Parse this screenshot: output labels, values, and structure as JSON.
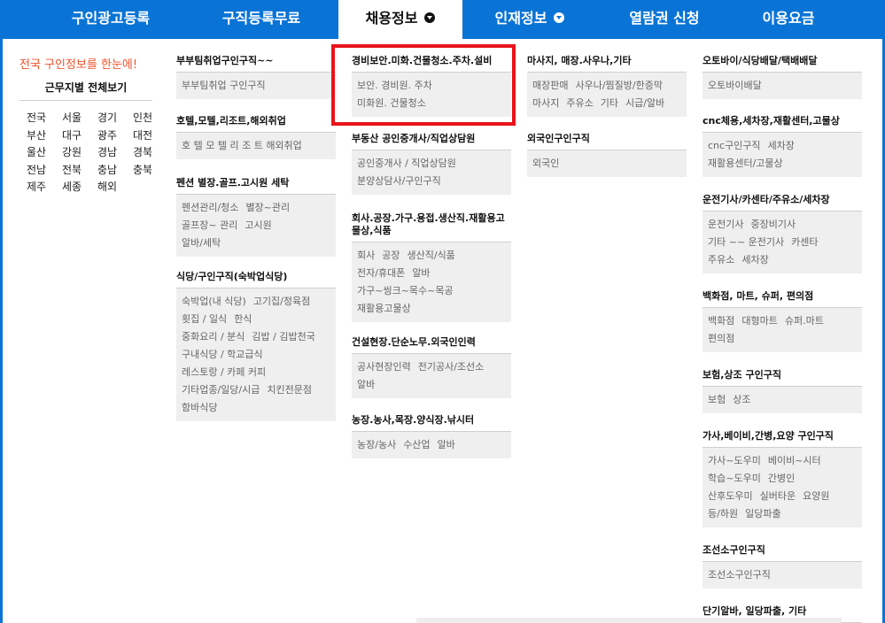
{
  "nav": {
    "items": [
      {
        "label": "구인광고등록",
        "active": false,
        "dropdown": false
      },
      {
        "label": "구직등록무료",
        "active": false,
        "dropdown": false
      },
      {
        "label": "채용정보",
        "active": true,
        "dropdown": true
      },
      {
        "label": "인재정보",
        "active": false,
        "dropdown": true
      },
      {
        "label": "열람권 신청",
        "active": false,
        "dropdown": false
      },
      {
        "label": "이용요금",
        "active": false,
        "dropdown": false
      }
    ],
    "color": "#0a74d6"
  },
  "region": {
    "headline": "전국 구인정보를 한눈에!",
    "title": "근무지별 전체보기",
    "cells": [
      "전국",
      "서울",
      "경기",
      "인천",
      "부산",
      "대구",
      "광주",
      "대전",
      "울산",
      "강원",
      "경남",
      "경북",
      "전남",
      "전북",
      "충남",
      "충북",
      "제주",
      "세종",
      "해외"
    ]
  },
  "columns": {
    "col1": [
      {
        "title": "부부팀취업구인구직~~",
        "lines": [
          [
            "부부팀취업 구인구직"
          ]
        ]
      },
      {
        "title": "호텔,모텔,리조트,해외취업",
        "lines": [
          [
            "호 텔 모 텔 리 조 트 해외취업"
          ]
        ]
      },
      {
        "title": "펜션 별장.골프.고시원 세탁",
        "lines": [
          [
            "펜션관리/청소",
            "별장~관리"
          ],
          [
            "골프장~ 관리",
            "고시원"
          ],
          [
            "알바/세탁"
          ]
        ]
      },
      {
        "title": "식당/구인구직(숙박업식당)",
        "lines": [
          [
            "숙박업(내 식당)",
            "고기집/정육점"
          ],
          [
            "횟집 / 일식",
            "한식"
          ],
          [
            "중화요리 / 분식",
            "김밥 / 김밥천국"
          ],
          [
            "구내식당 / 학교급식"
          ],
          [
            "레스토랑 / 카페 커피"
          ],
          [
            "기타업종/일당/시급",
            "치킨전문점"
          ],
          [
            "함바식당"
          ]
        ]
      }
    ],
    "col2": [
      {
        "title": "경비보안.미화.건물청소.주차.설비",
        "lines": [
          [
            "보안. 경비원. 주차"
          ],
          [
            "미화원. 건물청소"
          ]
        ]
      },
      {
        "title": "부동산 공인중개사/직업상담원",
        "lines": [
          [
            "공인중개사 / 직업상담원"
          ],
          [
            "분양상담사/구인구직"
          ]
        ]
      },
      {
        "title": "회사.공장.가구.용접.생산직.재활용고물상,식품",
        "lines": [
          [
            "회사",
            "공장",
            "생산직/식품"
          ],
          [
            "전자/휴대폰",
            "알바"
          ],
          [
            "가구~씽크~목수~목공"
          ],
          [
            "재활용고물상"
          ]
        ]
      },
      {
        "title": "건설현장.단순노무.외국인인력",
        "lines": [
          [
            "공사현장인력",
            "전기공사/조선소"
          ],
          [
            "알바"
          ]
        ]
      },
      {
        "title": "농장.농사,목장.양식장.낚시터",
        "lines": [
          [
            "농장/농사",
            "수산업",
            "알바"
          ]
        ]
      }
    ],
    "col3": [
      {
        "title": "마사지, 매장.사우나,기타",
        "lines": [
          [
            "매장판매",
            "사우나/찜질방/한증막"
          ],
          [
            "마사지",
            "주유소",
            "기타",
            "시급/알바"
          ]
        ]
      },
      {
        "title": "외국인구인구직",
        "lines": [
          [
            "외국인"
          ]
        ]
      }
    ],
    "col4": [
      {
        "title": "오토바이/식당배달/택배배달",
        "lines": [
          [
            "오토바이배달"
          ]
        ]
      },
      {
        "title": "cnc체용,세차장,재활센터,고물상",
        "lines": [
          [
            "cnc구인구직",
            "세차장"
          ],
          [
            "재활용센터/고물상"
          ]
        ]
      },
      {
        "title": "운전기사/카센타/주유소/세차장",
        "lines": [
          [
            "운전기사",
            "중장비기사"
          ],
          [
            "기타 ~~ 운전기사",
            "카센타"
          ],
          [
            "주유소",
            "세차장"
          ]
        ]
      },
      {
        "title": "백화점, 마트, 슈퍼, 편의점",
        "lines": [
          [
            "백화점",
            "대형마트",
            "슈퍼.마트"
          ],
          [
            "편의점"
          ]
        ]
      },
      {
        "title": "보험,상조 구인구직",
        "lines": [
          [
            "보험",
            "상조"
          ]
        ]
      },
      {
        "title": "가사,베이비,간병,요양 구인구직",
        "lines": [
          [
            "가사~도우미",
            "베이비~시터"
          ],
          [
            "학습~도우미",
            "간병인"
          ],
          [
            "산후도우미",
            "실버타운",
            "요양원"
          ],
          [
            "등/하원",
            "일당파출"
          ]
        ]
      },
      {
        "title": "조선소구인구직",
        "lines": [
          [
            "조선소구인구직"
          ]
        ]
      },
      {
        "title": "단기알바, 일당파출, 기타",
        "lines": []
      }
    ]
  },
  "highlight_color": "#e8141a",
  "headline_color": "#f0532b"
}
